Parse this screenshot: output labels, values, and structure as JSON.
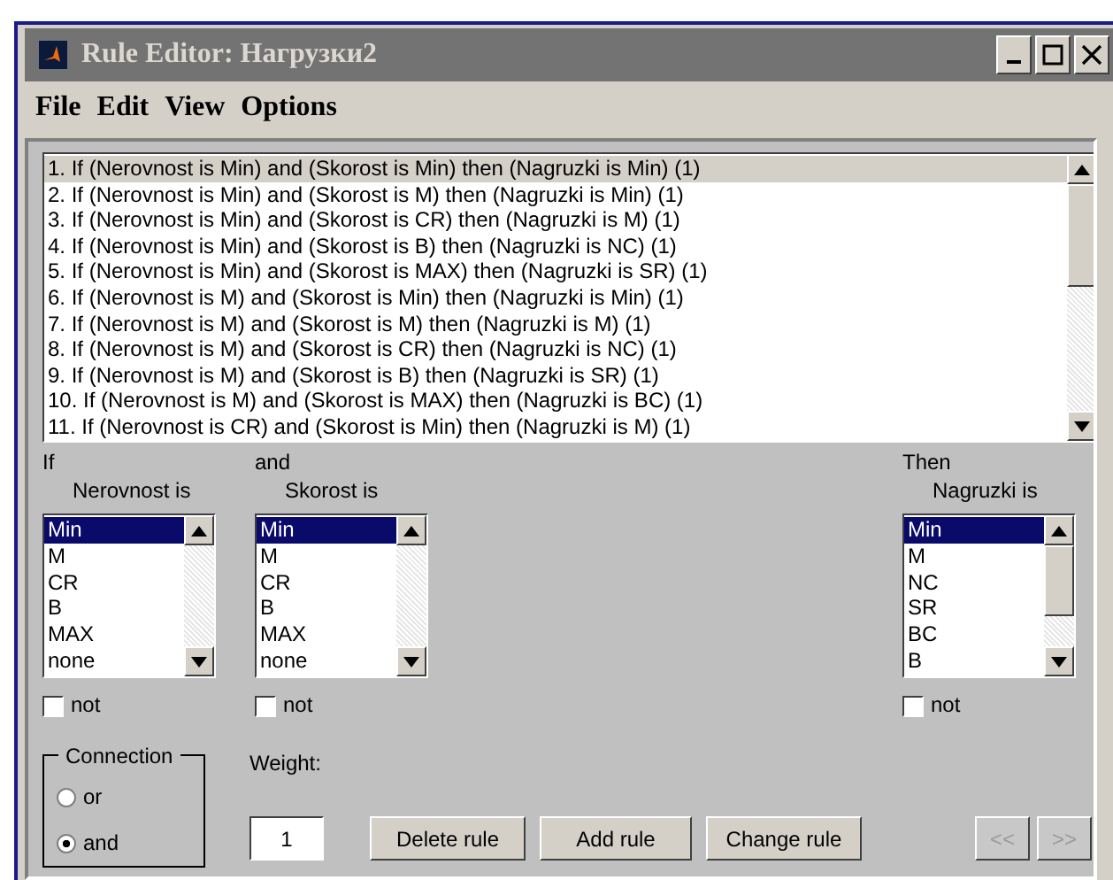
{
  "window": {
    "title": "Rule Editor: Нагрузки2"
  },
  "menu": [
    "File",
    "Edit",
    "View",
    "Options"
  ],
  "rules": [
    {
      "text": "1. If (Nerovnost is Min) and (Skorost is Min) then (Nagruzki is Min) (1)",
      "selected": true
    },
    {
      "text": "2. If (Nerovnost is Min) and (Skorost is M) then (Nagruzki is Min) (1)",
      "selected": false
    },
    {
      "text": "3. If (Nerovnost is Min) and (Skorost is CR) then (Nagruzki is M) (1)",
      "selected": false
    },
    {
      "text": "4. If (Nerovnost is Min) and (Skorost is B) then (Nagruzki is NC) (1)",
      "selected": false
    },
    {
      "text": "5. If (Nerovnost is Min) and (Skorost is MAX) then (Nagruzki is SR) (1)",
      "selected": false
    },
    {
      "text": "6. If (Nerovnost is M) and (Skorost is Min) then (Nagruzki is Min) (1)",
      "selected": false
    },
    {
      "text": "7. If (Nerovnost is M) and (Skorost is M) then (Nagruzki is M) (1)",
      "selected": false
    },
    {
      "text": "8. If (Nerovnost is M) and (Skorost is CR) then (Nagruzki is NC) (1)",
      "selected": false
    },
    {
      "text": "9. If (Nerovnost is M) and (Skorost is B) then (Nagruzki is SR) (1)",
      "selected": false
    },
    {
      "text": "10. If (Nerovnost is M) and (Skorost is MAX) then (Nagruzki is BC) (1)",
      "selected": false
    },
    {
      "text": "11. If (Nerovnost is CR) and (Skorost is Min) then (Nagruzki is M) (1)",
      "selected": false
    }
  ],
  "variables": [
    {
      "connector": "If",
      "label": "Nerovnost is",
      "options": [
        {
          "text": "Min",
          "selected": true
        },
        {
          "text": "M",
          "selected": false
        },
        {
          "text": "CR",
          "selected": false
        },
        {
          "text": "B",
          "selected": false
        },
        {
          "text": "MAX",
          "selected": false
        },
        {
          "text": "none",
          "selected": false
        }
      ],
      "not": {
        "label": "not",
        "checked": false
      }
    },
    {
      "connector": "and",
      "label": "Skorost is",
      "options": [
        {
          "text": "Min",
          "selected": true
        },
        {
          "text": "M",
          "selected": false
        },
        {
          "text": "CR",
          "selected": false
        },
        {
          "text": "B",
          "selected": false
        },
        {
          "text": "MAX",
          "selected": false
        },
        {
          "text": "none",
          "selected": false
        }
      ],
      "not": {
        "label": "not",
        "checked": false
      }
    },
    {
      "connector": "Then",
      "label": "Nagruzki is",
      "options": [
        {
          "text": "Min",
          "selected": true
        },
        {
          "text": "M",
          "selected": false
        },
        {
          "text": "NC",
          "selected": false
        },
        {
          "text": "SR",
          "selected": false
        },
        {
          "text": "BC",
          "selected": false
        },
        {
          "text": "B",
          "selected": false
        }
      ],
      "not": {
        "label": "not",
        "checked": false
      }
    }
  ],
  "connection": {
    "title": "Connection",
    "options": [
      {
        "label": "or",
        "selected": false
      },
      {
        "label": "and",
        "selected": true
      }
    ]
  },
  "weight": {
    "label": "Weight:",
    "value": "1"
  },
  "buttons": [
    {
      "label": "Delete rule",
      "disabled": false
    },
    {
      "label": "Add rule",
      "disabled": false
    },
    {
      "label": "Change rule",
      "disabled": false
    }
  ],
  "nav_buttons": [
    {
      "label": "<<",
      "disabled": true
    },
    {
      "label": ">>",
      "disabled": true
    }
  ]
}
